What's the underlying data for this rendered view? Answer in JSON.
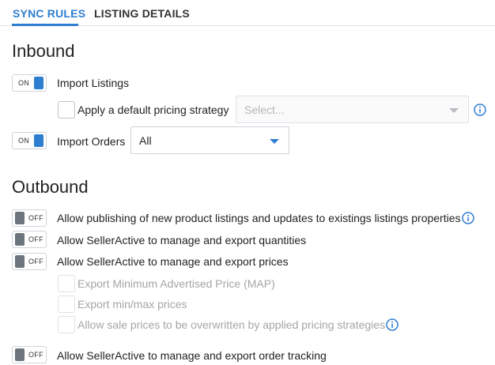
{
  "tabs": {
    "sync_rules": "SYNC RULES",
    "listing_details": "LISTING DETAILS"
  },
  "inbound": {
    "title": "Inbound",
    "import_listings": {
      "toggle": "ON",
      "label": "Import Listings"
    },
    "pricing_strategy": {
      "label": "Apply a default pricing strategy",
      "placeholder": "Select..."
    },
    "import_orders": {
      "toggle": "ON",
      "label": "Import Orders",
      "selected": "All"
    }
  },
  "outbound": {
    "title": "Outbound",
    "publishing": {
      "toggle": "OFF",
      "label": "Allow publishing of new product listings and updates to existings listings properties"
    },
    "quantities": {
      "toggle": "OFF",
      "label": "Allow SellerActive to manage and export quantities"
    },
    "prices": {
      "toggle": "OFF",
      "label": "Allow SellerActive to manage and export prices"
    },
    "map": {
      "label": "Export Minimum Advertised Price (MAP)"
    },
    "minmax": {
      "label": "Export min/max prices"
    },
    "sale_prices": {
      "label": "Allow sale prices to be overwritten by applied pricing strategies"
    },
    "order_tracking": {
      "toggle": "OFF",
      "label": "Allow SellerActive to manage and export order tracking"
    }
  },
  "colors": {
    "accent": "#2f7fd1",
    "toggle_off_knob": "#6c757d",
    "disabled_text": "#a5a5a5"
  },
  "icons": [
    "info-circle-icon",
    "caret-down-icon"
  ]
}
